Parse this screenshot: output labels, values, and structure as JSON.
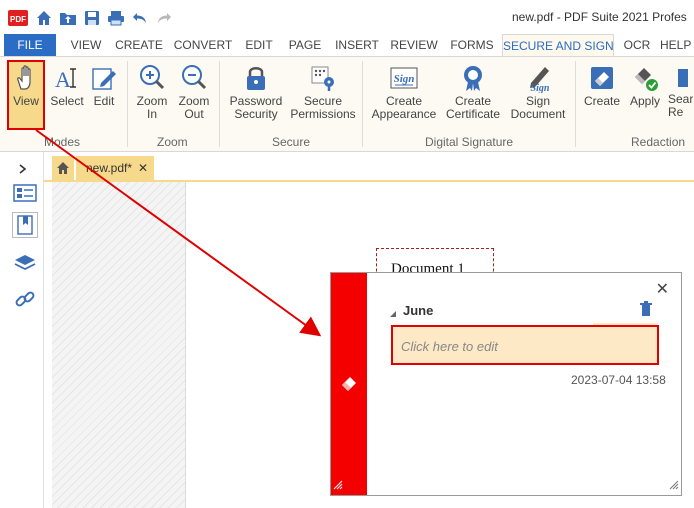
{
  "window": {
    "title": "new.pdf   -   PDF Suite 2021 Profes"
  },
  "menu": {
    "tabs": [
      "FILE",
      "VIEW",
      "CREATE",
      "CONVERT",
      "EDIT",
      "PAGE",
      "INSERT",
      "REVIEW",
      "FORMS",
      "SECURE AND SIGN",
      "OCR",
      "HELP"
    ],
    "active": "SECURE AND SIGN"
  },
  "ribbon": {
    "buttons": {
      "view": "View",
      "select": "Select",
      "edit": "Edit",
      "zoom_in": "Zoom In",
      "zoom_out": "Zoom Out",
      "password_security": "Password Security",
      "secure_permissions": "Secure Permissions",
      "create_appearance": "Create Appearance",
      "create_certificate": "Create Certificate",
      "sign_document": "Sign Document",
      "create": "Create",
      "apply": "Apply",
      "search_redaction": "Sear Re"
    },
    "groups": {
      "modes": "Modes",
      "zoom": "Zoom",
      "secure": "Secure",
      "digital_signature": "Digital Signature",
      "redaction": "Redaction"
    }
  },
  "document": {
    "tab_label": "new.pdf*",
    "title": "Document 1"
  },
  "comment_popup": {
    "author": "June",
    "placeholder": "Click here to edit",
    "timestamp": "2023-07-04 13:58"
  },
  "colors": {
    "brand_blue": "#2b6cc4",
    "highlight_red": "#e00000",
    "popup_bar": "#f40000",
    "tab_yellow": "#f6d98a"
  }
}
